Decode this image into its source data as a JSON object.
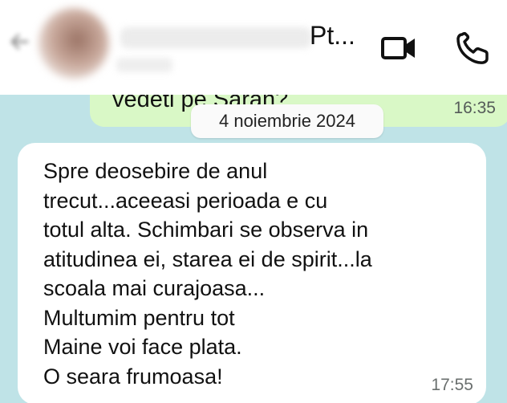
{
  "header": {
    "contact_name": "Pt...",
    "video_call_icon": "video-camera-icon",
    "voice_call_icon": "phone-icon",
    "back_icon": "back-arrow-icon"
  },
  "chat": {
    "outgoing_message": {
      "text": "vedeti pe Sarah?",
      "time": "16:35"
    },
    "date_separator": "4 noiembrie 2024",
    "incoming_message": {
      "lines": [
        "Spre deosebire de anul",
        "trecut...aceeasi perioada e cu",
        "totul alta. Schimbari se observa in",
        "atitudinea ei, starea ei de spirit...la",
        "scoala mai curajoasa...",
        "Multumim pentru tot",
        "Maine voi face plata.",
        "O seara frumoasa!"
      ],
      "time": "17:55"
    }
  },
  "colors": {
    "chat_background": "#bfe3e7",
    "outgoing_bubble": "#d9f8c6",
    "incoming_bubble": "#ffffff",
    "header_background": "#ffffff"
  }
}
